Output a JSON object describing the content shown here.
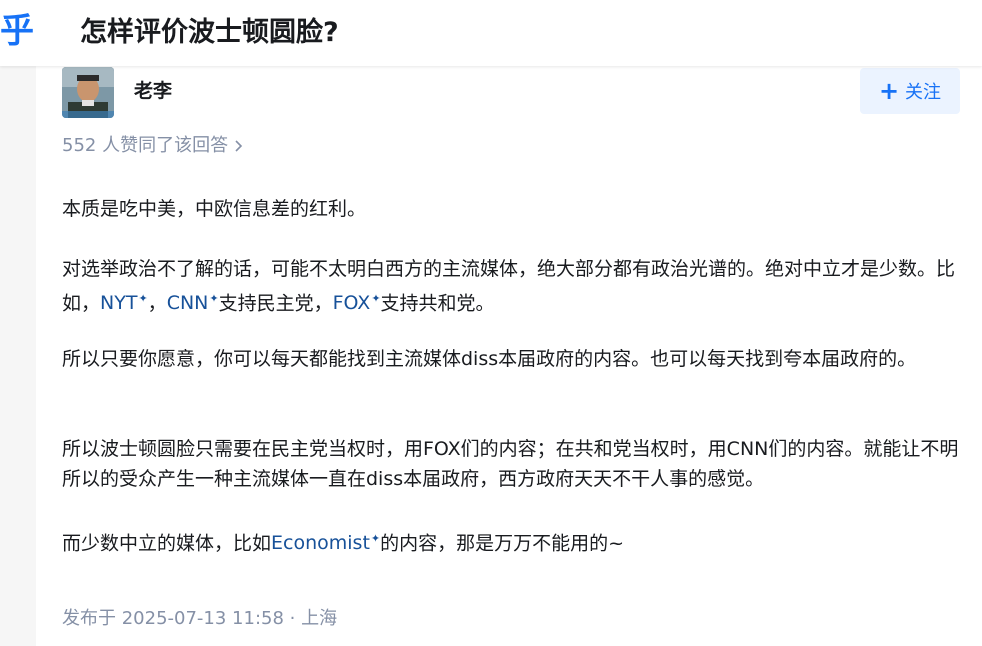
{
  "header": {
    "logo_text": "乎",
    "question_title": "怎样评价波士顿圆脸?"
  },
  "author": {
    "name": "老李",
    "follow_label": "关注"
  },
  "upvote_text": "552 人赞同了该回答",
  "answer": {
    "p1": "本质是吃中美，中欧信息差的红利。",
    "p2_a": "对选举政治不了解的话，可能不太明白西方的主流媒体，绝大部分都有政治光谱的。绝对中立才是少数。比如，",
    "p2_link1": "NYT",
    "p2_sep": "，",
    "p2_link2": "CNN",
    "p2_b": "支持民主党，",
    "p2_link3": "FOX",
    "p2_c": "支持共和党。",
    "p3": "所以只要你愿意，你可以每天都能找到主流媒体diss本届政府的内容。也可以每天找到夸本届政府的。",
    "p4": "所以波士顿圆脸只需要在民主党当权时，用FOX们的内容；在共和党当权时，用CNN们的内容。就能让不明所以的受众产生一种主流媒体一直在diss本届政府，西方政府天天不干人事的感觉。",
    "p5_a": "而少数中立的媒体，比如",
    "p5_link": "Economist",
    "p5_b": "的内容，那是万万不能用的~"
  },
  "meta": {
    "published": "发布于 2025-07-13 11:58 · 上海"
  },
  "colors": {
    "brand": "#1772f6",
    "link": "#175199",
    "muted": "#8590a6"
  }
}
